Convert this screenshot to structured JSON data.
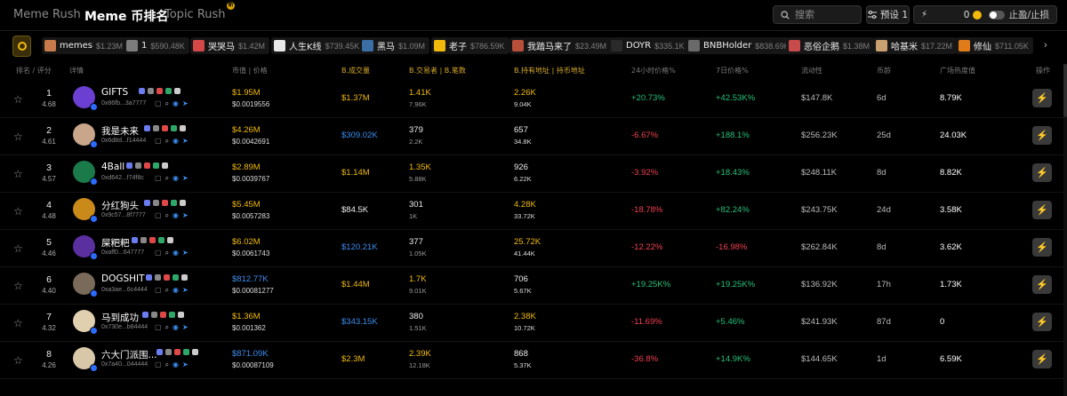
{
  "nav": {
    "tabs": [
      {
        "label": "Meme Rush"
      },
      {
        "label": "Meme 币排名"
      },
      {
        "label": "Topic Rush"
      }
    ],
    "topic_badge": "新",
    "search_placeholder": "搜索",
    "preset_label": "预设 1",
    "amount": "0",
    "stop_label": "止盈/止损"
  },
  "ticker": [
    {
      "name": "memes",
      "value": "$1.23M",
      "color": "#c77a4a"
    },
    {
      "name": "1",
      "value": "$590.48K",
      "color": "#7c7c7c"
    },
    {
      "name": "哭哭马",
      "value": "$1.42M",
      "color": "#d44848"
    },
    {
      "name": "人生K线",
      "value": "$739.45K",
      "color": "#e8e8e8"
    },
    {
      "name": "黑马",
      "value": "$1.09M",
      "color": "#3a6ea5"
    },
    {
      "name": "老子",
      "value": "$786.59K",
      "color": "#f0b90b"
    },
    {
      "name": "我踏马来了",
      "value": "$23.49M",
      "color": "#b84f3a"
    },
    {
      "name": "DOYR",
      "value": "$335.1K",
      "color": "#2a2a2a"
    },
    {
      "name": "BNBHolder",
      "value": "$838.69K",
      "color": "#6a6a6a"
    },
    {
      "name": "恶俗企鹅",
      "value": "$1.38M",
      "color": "#c94a4a"
    },
    {
      "name": "哈基米",
      "value": "$17.22M",
      "color": "#c9a070"
    },
    {
      "name": "修仙",
      "value": "$711.05K",
      "color": "#e07b1a"
    }
  ],
  "columns": {
    "rank": "排名 / 评分",
    "detail": "详情",
    "mc_price": "市值 | 价格",
    "volume": "B.成交量",
    "trades": "B.交易者 | B.笔数",
    "holders": "B.持有地址 | 持币地址",
    "change_24h": "24小时价格%",
    "change_7d": "7日价格%",
    "liquidity": "流动性",
    "age": "币龄",
    "heat": "广场热度值",
    "action": "操作"
  },
  "rows": [
    {
      "rank": "1",
      "score": "4.68",
      "name": "GIFTS",
      "addr": "0x86fb...3a7777",
      "mc": "$1.95M",
      "mc_color": "y",
      "price": "$0.0019556",
      "vol": "$1.37M",
      "vol_color": "y",
      "traders": "1.41K",
      "traders_color": "y",
      "txs": "7.96K",
      "holders": "2.26K",
      "holders_color": "y",
      "holders_all": "9.04K",
      "c24": "+20.73%",
      "c24_color": "g",
      "c7d": "+42.53K%",
      "c7d_color": "g",
      "liq": "$147.8K",
      "age": "6d",
      "heat": "8.79K",
      "avatar": "#6b3fd1"
    },
    {
      "rank": "2",
      "score": "4.61",
      "name": "我是未来",
      "addr": "0x6d8d...f14444",
      "mc": "$4.26M",
      "mc_color": "y",
      "price": "$0.0042691",
      "vol": "$309.02K",
      "vol_color": "b",
      "traders": "379",
      "traders_color": "w",
      "txs": "2.2K",
      "holders": "657",
      "holders_color": "w",
      "holders_all": "34.8K",
      "c24": "-6.67%",
      "c24_color": "r",
      "c7d": "+188.1%",
      "c7d_color": "g",
      "liq": "$256.23K",
      "age": "25d",
      "heat": "24.03K",
      "avatar": "#c9a58a"
    },
    {
      "rank": "3",
      "score": "4.57",
      "name": "4Ball",
      "addr": "0xd642...f74f8c",
      "mc": "$2.89M",
      "mc_color": "y",
      "price": "$0.0039767",
      "vol": "$1.14M",
      "vol_color": "y",
      "traders": "1.35K",
      "traders_color": "y",
      "txs": "5.88K",
      "holders": "926",
      "holders_color": "w",
      "holders_all": "6.22K",
      "c24": "-3.92%",
      "c24_color": "r",
      "c7d": "+18.43%",
      "c7d_color": "g",
      "liq": "$248.11K",
      "age": "8d",
      "heat": "8.82K",
      "avatar": "#1a7a4a"
    },
    {
      "rank": "4",
      "score": "4.48",
      "name": "分红狗头",
      "addr": "0x9c57...8f7777",
      "mc": "$5.45M",
      "mc_color": "y",
      "price": "$0.0057283",
      "vol": "$84.5K",
      "vol_color": "w",
      "traders": "301",
      "traders_color": "w",
      "txs": "1K",
      "holders": "4.28K",
      "holders_color": "y",
      "holders_all": "33.72K",
      "c24": "-18.78%",
      "c24_color": "r",
      "c7d": "+82.24%",
      "c7d_color": "g",
      "liq": "$243.75K",
      "age": "24d",
      "heat": "3.58K",
      "avatar": "#c98a1a"
    },
    {
      "rank": "5",
      "score": "4.46",
      "name": "屎粑粑",
      "addr": "0xaff0...647777",
      "mc": "$6.02M",
      "mc_color": "y",
      "price": "$0.0061743",
      "vol": "$120.21K",
      "vol_color": "b",
      "traders": "377",
      "traders_color": "w",
      "txs": "1.05K",
      "holders": "25.72K",
      "holders_color": "y",
      "holders_all": "41.44K",
      "c24": "-12.22%",
      "c24_color": "r",
      "c7d": "-16.98%",
      "c7d_color": "r",
      "liq": "$262.84K",
      "age": "8d",
      "heat": "3.62K",
      "avatar": "#5a2fa0"
    },
    {
      "rank": "6",
      "score": "4.40",
      "name": "DOGSHIT",
      "addr": "0xa3ae...6c4444",
      "mc": "$812.77K",
      "mc_color": "b",
      "price": "$0.00081277",
      "vol": "$1.44M",
      "vol_color": "y",
      "traders": "1.7K",
      "traders_color": "y",
      "txs": "9.01K",
      "holders": "706",
      "holders_color": "w",
      "holders_all": "5.67K",
      "c24": "+19.25K%",
      "c24_color": "g",
      "c7d": "+19.25K%",
      "c7d_color": "g",
      "liq": "$136.92K",
      "age": "17h",
      "heat": "1.73K",
      "avatar": "#7a6a5a"
    },
    {
      "rank": "7",
      "score": "4.32",
      "name": "马到成功",
      "addr": "0x730e...b84444",
      "mc": "$1.36M",
      "mc_color": "y",
      "price": "$0.001362",
      "vol": "$343.15K",
      "vol_color": "b",
      "traders": "380",
      "traders_color": "w",
      "txs": "1.51K",
      "holders": "2.38K",
      "holders_color": "y",
      "holders_all": "10.72K",
      "c24": "-11.69%",
      "c24_color": "r",
      "c7d": "+5.46%",
      "c7d_color": "g",
      "liq": "$241.93K",
      "age": "87d",
      "heat": "0",
      "avatar": "#e0d0b0"
    },
    {
      "rank": "8",
      "score": "4.26",
      "name": "六大门派围...",
      "addr": "0x7a40...044444",
      "mc": "$871.09K",
      "mc_color": "b",
      "price": "$0.00087109",
      "vol": "$2.3M",
      "vol_color": "y",
      "traders": "2.39K",
      "traders_color": "y",
      "txs": "12.18K",
      "holders": "868",
      "holders_color": "w",
      "holders_all": "5.37K",
      "c24": "-36.8%",
      "c24_color": "r",
      "c7d": "+14.9K%",
      "c7d_color": "g",
      "liq": "$144.65K",
      "age": "1d",
      "heat": "6.59K",
      "avatar": "#d8c8a8"
    }
  ]
}
